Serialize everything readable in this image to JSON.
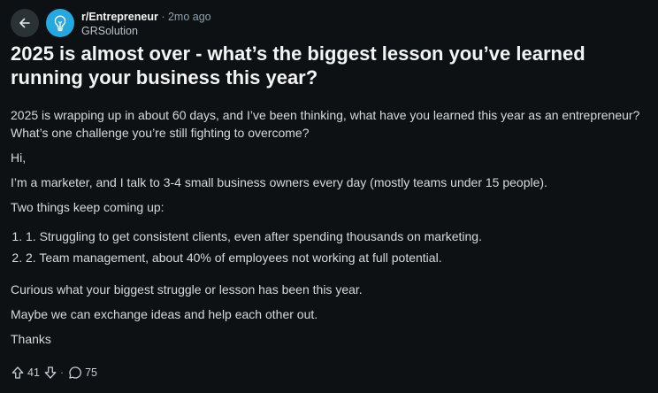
{
  "header": {
    "subreddit": "r/Entrepreneur",
    "separator": "·",
    "time_ago": "2mo ago",
    "author": "GRSolution"
  },
  "post": {
    "title": "2025 is almost over - what’s the biggest lesson you’ve learned running your business this year?",
    "intro": "2025 is wrapping up in about 60 days, and I’ve been thinking, what have you learned this year as an entrepreneur? What’s one challenge you’re still fighting to overcome?",
    "greeting": "Hi,",
    "paragraph1": "I’m a marketer, and I talk to 3-4 small business owners every day (mostly teams under 15 people).",
    "paragraph2": "Two things keep coming up:",
    "list": [
      "1. Struggling to get consistent clients, even after spending thousands on marketing.",
      "2. Team management, about 40% of employees not working at full potential."
    ],
    "paragraph3": "Curious what your biggest struggle or lesson has been this year.",
    "paragraph4": "Maybe we can exchange ideas and help each other out.",
    "signoff": "Thanks"
  },
  "actions": {
    "upvotes": "41",
    "separator": "·",
    "comments": "75"
  },
  "icons": {
    "back": "back-arrow-icon",
    "subreddit": "lightbulb-icon",
    "upvote": "upvote-icon",
    "downvote": "downvote-icon",
    "comment": "comment-icon"
  },
  "colors": {
    "background": "#0e1113",
    "avatar": "#23a8e0",
    "back_button": "#2a3236",
    "title": "#f2f4f5",
    "body_text": "#d7dadc",
    "meta_text": "#8ba2ad"
  }
}
